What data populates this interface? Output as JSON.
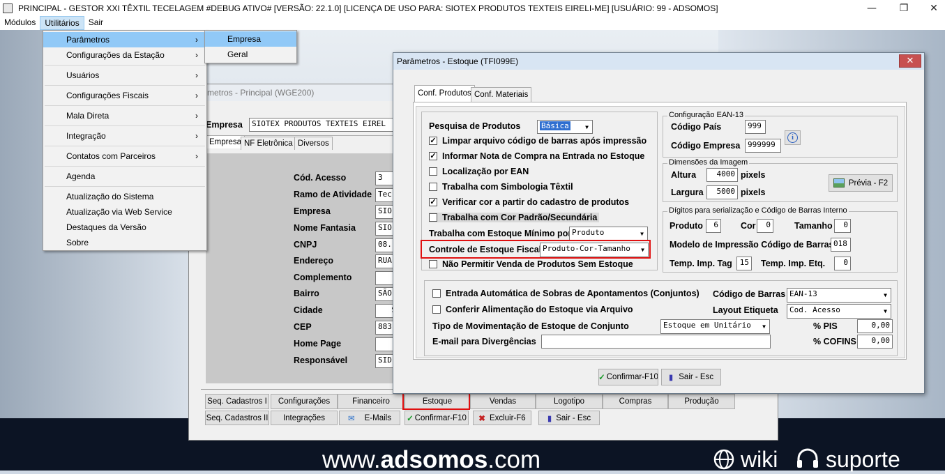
{
  "titlebar": {
    "title": "PRINCIPAL   - GESTOR XXI TÊXTIL TECELAGEM #DEBUG ATIVO# [VERSÃO: 22.1.0] [LICENÇA DE USO PARA: SIOTEX PRODUTOS TEXTEIS EIRELI-ME] [USUÁRIO: 99 - ADSOMOS]",
    "minimize": "—",
    "restore": "❐",
    "close": "✕"
  },
  "menubar": [
    "Módulos",
    "Utilitários",
    "Sair"
  ],
  "utilitarios_menu": [
    {
      "label": "Parâmetros",
      "arrow": "›"
    },
    {
      "label": "Configurações da Estação",
      "arrow": "›"
    },
    {
      "label": "Usuários",
      "arrow": "›"
    },
    {
      "label": "Configurações Fiscais",
      "arrow": "›"
    },
    {
      "label": "Mala Direta",
      "arrow": "›"
    },
    {
      "label": "Integração",
      "arrow": "›"
    },
    {
      "label": "Contatos com Parceiros",
      "arrow": "›"
    },
    {
      "label": "Agenda"
    },
    {
      "label": "Atualização do Sistema"
    },
    {
      "label": "Atualização via Web Service"
    },
    {
      "label": "Destaques da Versão"
    },
    {
      "label": "Sobre"
    }
  ],
  "parametros_submenu": [
    "Empresa",
    "Geral"
  ],
  "bgwin": {
    "title": "metros - Principal (WGE200)",
    "empresa_label": "Empresa",
    "empresa_value": "SIOTEX PRODUTOS TEXTEIS EIREL",
    "tabs": [
      "Empresa",
      "NF Eletrônica",
      "Diversos"
    ],
    "fields": [
      {
        "label": "Cód. Acesso",
        "value": "3"
      },
      {
        "label": "Ramo de Atividade",
        "value": "Tec"
      },
      {
        "label": "Empresa",
        "value": "SIO"
      },
      {
        "label": "Nome Fantasia",
        "value": "SIO"
      },
      {
        "label": "CNPJ",
        "value": "08."
      },
      {
        "label": "Endereço",
        "value": "RUA"
      },
      {
        "label": "Complemento",
        "value": ""
      },
      {
        "label": "Bairro",
        "value": "SÃO"
      },
      {
        "label": "Cidade",
        "value": "S"
      },
      {
        "label": "CEP",
        "value": "883"
      },
      {
        "label": "Home Page",
        "value": ""
      },
      {
        "label": "Responsável",
        "value": "SID"
      }
    ],
    "buttons_row1": [
      "Seq. Cadastros I",
      "Configurações",
      "Financeiro",
      "Estoque",
      "Vendas",
      "Logotipo",
      "Compras",
      "Produção"
    ],
    "buttons_row2": [
      "Seq. Cadastros II",
      "Integrações",
      "E-Mails",
      "Confirmar-F10",
      "Excluir-F6",
      "Sair - Esc"
    ]
  },
  "dialog": {
    "title": "Parâmetros - Estoque (TFI099E)",
    "close": "✕",
    "tabs": [
      "Conf. Produtos",
      "Conf. Materiais"
    ],
    "pesquisa_label": "Pesquisa de Produtos",
    "pesquisa_value": "Básica",
    "checks": [
      {
        "label": "Limpar arquivo código de barras após impressão",
        "checked": "✓"
      },
      {
        "label": "Informar Nota de Compra na Entrada no Estoque",
        "checked": "✓"
      },
      {
        "label": "Localização por EAN",
        "checked": ""
      },
      {
        "label": "Trabalha com Simbologia Têxtil",
        "checked": ""
      },
      {
        "label": "Verificar cor a partir do cadastro de produtos",
        "checked": "✓"
      },
      {
        "label": "Trabalha com Cor Padrão/Secundária",
        "checked": ""
      }
    ],
    "estoque_minimo_label": "Trabalha com Estoque Mínimo por",
    "estoque_minimo_value": "Produto",
    "controle_fiscal_label": "Controle de Estoque Fiscal",
    "controle_fiscal_value": "Produto-Cor-Tamanho",
    "nao_permitir_label": "Não Permitir Venda de Produtos Sem Estoque",
    "ean": {
      "title": "Configuração EAN-13",
      "codigo_pais_label": "Código País",
      "codigo_pais": "999",
      "codigo_empresa_label": "Código Empresa",
      "codigo_empresa": "999999",
      "info_icon": "i"
    },
    "dim": {
      "title": "Dimensões da Imagem",
      "altura_label": "Altura",
      "altura": "4000",
      "largura_label": "Largura",
      "largura": "5000",
      "unit": "pixels",
      "previa": "Prévia - F2"
    },
    "digitos": {
      "title": "Dígitos para serialização e Código de Barras Interno",
      "produto_label": "Produto",
      "produto": "6",
      "cor_label": "Cor",
      "cor": "0",
      "tamanho_label": "Tamanho",
      "tamanho": "0",
      "modelo_label": "Modelo de Impressão Código de Barras",
      "modelo": "018",
      "temp_tag_label": "Temp. Imp. Tag",
      "temp_tag": "15",
      "temp_etq_label": "Temp. Imp. Etq.",
      "temp_etq": "0"
    },
    "lower": {
      "entrada_auto": "Entrada Automática de Sobras de Apontamentos (Conjuntos)",
      "conferir": "Conferir Alimentação do Estoque via Arquivo",
      "tipo_mov_label": "Tipo de Movimentação de Estoque de Conjunto",
      "tipo_mov_value": "Estoque em Unitário",
      "email_label": "E-mail para Divergências",
      "email_value": "",
      "cod_barras_label": "Código de Barras",
      "cod_barras_value": "EAN-13",
      "layout_label": "Layout Etiqueta",
      "layout_value": "Cod. Acesso",
      "pis_label": "% PIS",
      "pis_value": "0,00",
      "cofins_label": "% COFINS",
      "cofins_value": "0,00"
    },
    "confirmar": "Confirmar-F10",
    "sair": "Sair - Esc"
  },
  "footer": {
    "site_prefix": "www.",
    "site_bold": "adsomos",
    "site_suffix": ".com",
    "wiki": "wiki",
    "suporte": "suporte"
  },
  "colors": {
    "menu_highlight": "#91c9f7",
    "red_box": "#e01010",
    "close_red": "#c75050"
  }
}
